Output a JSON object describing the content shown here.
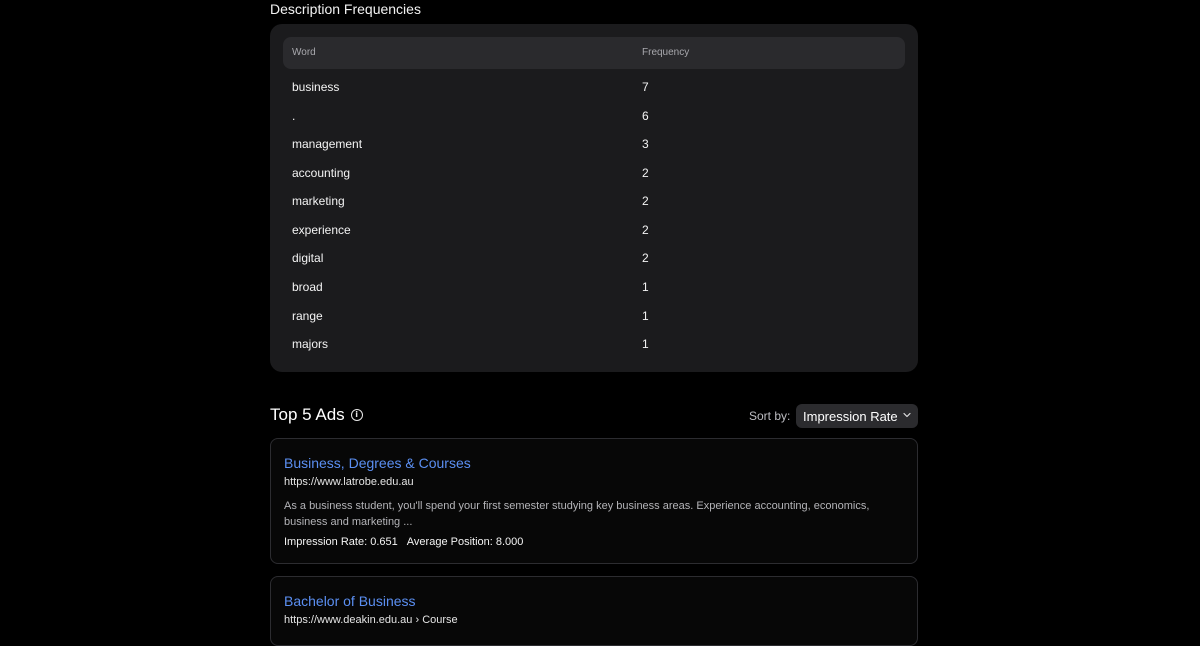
{
  "frequencies": {
    "title": "Description Frequencies",
    "columns": {
      "word": "Word",
      "frequency": "Frequency"
    },
    "rows": [
      {
        "word": "business",
        "count": "7"
      },
      {
        "word": ".",
        "count": "6"
      },
      {
        "word": "management",
        "count": "3"
      },
      {
        "word": "accounting",
        "count": "2"
      },
      {
        "word": "marketing",
        "count": "2"
      },
      {
        "word": "experience",
        "count": "2"
      },
      {
        "word": "digital",
        "count": "2"
      },
      {
        "word": "broad",
        "count": "1"
      },
      {
        "word": "range",
        "count": "1"
      },
      {
        "word": "majors",
        "count": "1"
      }
    ]
  },
  "ads": {
    "title": "Top 5 Ads",
    "sort_label": "Sort by:",
    "sort_value": "Impression Rate",
    "items": [
      {
        "title": "Business, Degrees & Courses",
        "url": "https://www.latrobe.edu.au",
        "description": "As a business student, you'll spend your first semester studying key business areas. Experience accounting, economics, business and marketing ...",
        "impression_rate": "Impression Rate: 0.651",
        "average_position": "Average Position: 8.000"
      },
      {
        "title": "Bachelor of Business",
        "url": "https://www.deakin.edu.au › Course"
      }
    ]
  },
  "colors": {
    "background": "#000000",
    "card": "#1b1b1d",
    "link": "#5b8ff2"
  }
}
